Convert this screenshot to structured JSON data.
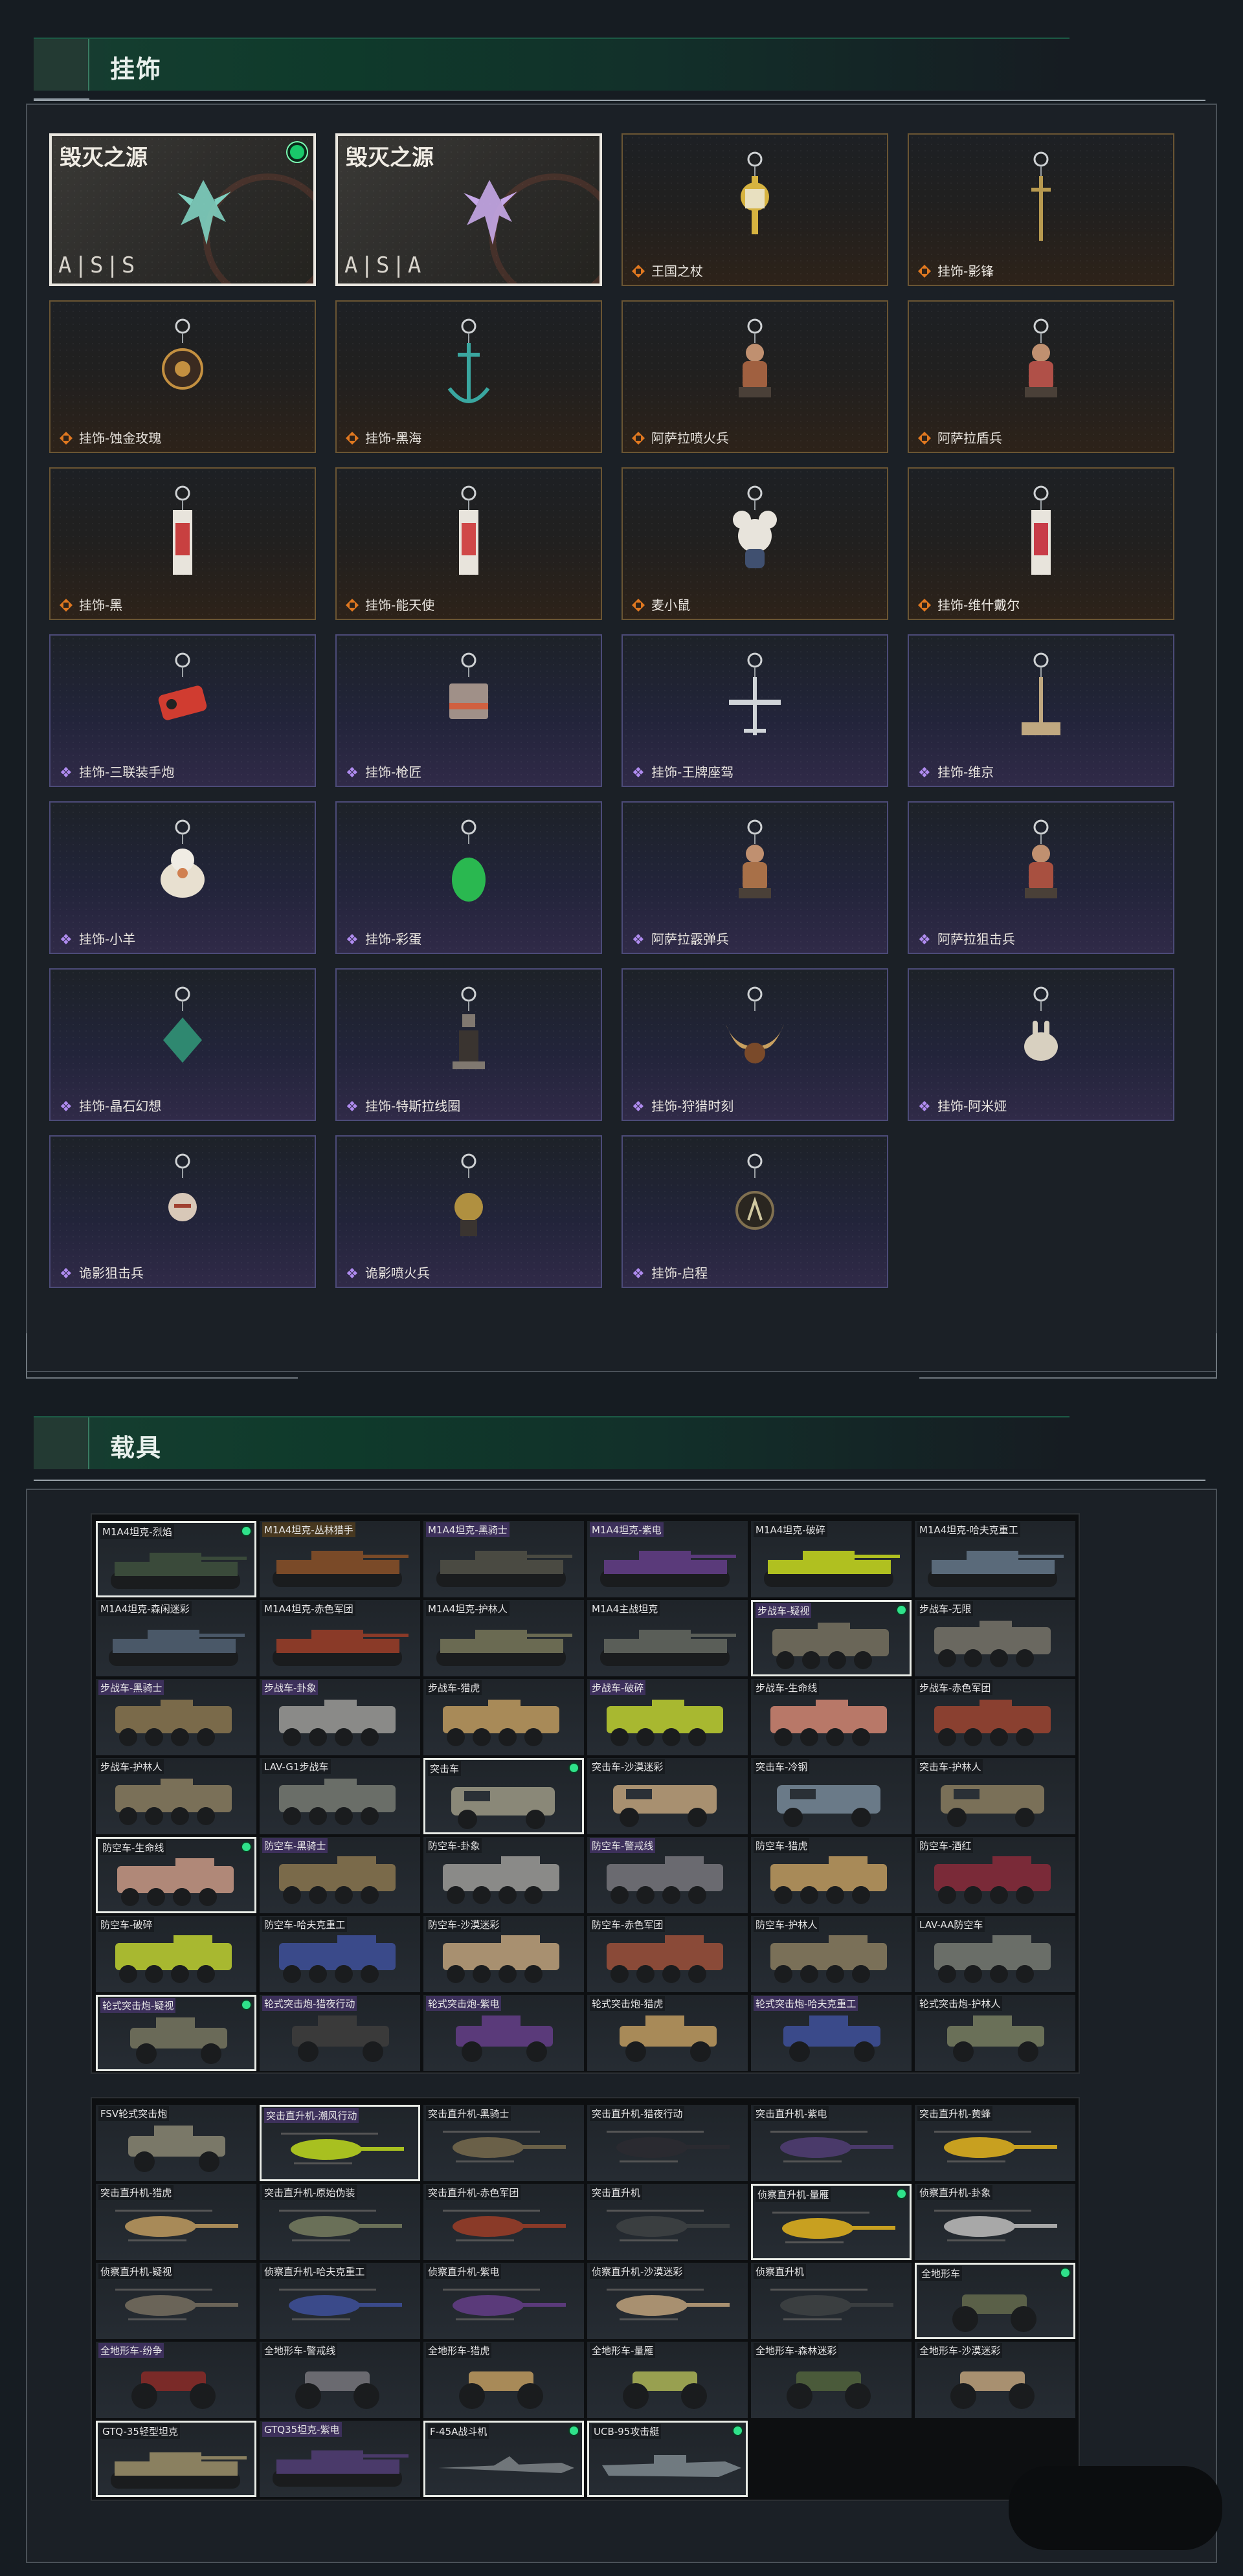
{
  "sections": {
    "accessories": {
      "title": "挂饰"
    },
    "vehicles": {
      "title": "载具"
    }
  },
  "accessory_cards": [
    {
      "label": "毁灭之源",
      "brand": "A|S|S",
      "style": "white",
      "equipped": true,
      "charm": "blade-charm-icon",
      "color": "#7fd0c0"
    },
    {
      "label": "毁灭之源",
      "brand": "A|S|A",
      "style": "white",
      "equipped": false,
      "charm": "blade-charm-icon",
      "color": "#c6a8e8"
    },
    {
      "label": "王国之杖",
      "style": "gold",
      "charm": "scepter-charm-icon",
      "color": "#d6b340"
    },
    {
      "label": "挂饰-影锋",
      "style": "gold",
      "charm": "sword-charm-icon",
      "color": "#b89a50"
    },
    {
      "label": "挂饰-蚀金玫瑰",
      "style": "gold",
      "charm": "rose-charm-icon",
      "color": "#c49040"
    },
    {
      "label": "挂饰-黑海",
      "style": "gold",
      "charm": "anchor-charm-icon",
      "color": "#3aa7a0"
    },
    {
      "label": "阿萨拉喷火兵",
      "style": "gold",
      "charm": "soldier-charm-icon",
      "color": "#a06040"
    },
    {
      "label": "阿萨拉盾兵",
      "style": "gold",
      "charm": "soldier-charm-icon",
      "color": "#b05048"
    },
    {
      "label": "挂饰-黑",
      "style": "gold",
      "charm": "tag-charm-icon",
      "color": "#c84040"
    },
    {
      "label": "挂饰-能天使",
      "style": "gold",
      "charm": "tag-charm-icon",
      "color": "#d04848"
    },
    {
      "label": "麦小鼠",
      "style": "gold",
      "charm": "mouse-charm-icon",
      "color": "#e8e4dc"
    },
    {
      "label": "挂饰-维什戴尔",
      "style": "gold",
      "charm": "tag-charm-icon",
      "color": "#c83c48"
    },
    {
      "label": "挂饰-三联装手炮",
      "style": "purple",
      "charm": "cannon-charm-icon",
      "color": "#d03c30"
    },
    {
      "label": "挂饰-枪匠",
      "style": "purple",
      "charm": "box-charm-icon",
      "color": "#a09088"
    },
    {
      "label": "挂饰-王牌座驾",
      "style": "purple",
      "charm": "plane-charm-icon",
      "color": "#d0d4d8"
    },
    {
      "label": "挂饰-维京",
      "style": "purple",
      "charm": "hammer-charm-icon",
      "color": "#c0a880"
    },
    {
      "label": "挂饰-小羊",
      "style": "purple",
      "charm": "sheep-charm-icon",
      "color": "#e8e0d0"
    },
    {
      "label": "挂饰-彩蛋",
      "style": "purple",
      "charm": "egg-charm-icon",
      "color": "#2ab850"
    },
    {
      "label": "阿萨拉霰弹兵",
      "style": "purple",
      "charm": "soldier-charm-icon",
      "color": "#a87048"
    },
    {
      "label": "阿萨拉狙击兵",
      "style": "purple",
      "charm": "soldier-charm-icon",
      "color": "#a85040"
    },
    {
      "label": "挂饰-晶石幻想",
      "style": "purple",
      "charm": "crystal-charm-icon",
      "color": "#2f8870"
    },
    {
      "label": "挂饰-特斯拉线圈",
      "style": "purple",
      "charm": "coil-charm-icon",
      "color": "#807870"
    },
    {
      "label": "挂饰-狩猎时刻",
      "style": "purple",
      "charm": "antler-charm-icon",
      "color": "#c8a060"
    },
    {
      "label": "挂饰-阿米娅",
      "style": "purple",
      "charm": "bunny-charm-icon",
      "color": "#d8d0c0"
    },
    {
      "label": "诡影狙击兵",
      "style": "purple",
      "charm": "mask-charm-icon",
      "color": "#d8c8b8"
    },
    {
      "label": "诡影喷火兵",
      "style": "purple",
      "charm": "tank-charm-icon",
      "color": "#b09040"
    },
    {
      "label": "挂饰-启程",
      "style": "purple",
      "charm": "badge-charm-icon",
      "color": "#807050"
    }
  ],
  "vehicle_groups": [
    {
      "tiles": [
        {
          "label": "M1A4坦克-烈焰",
          "kind": "tank",
          "color": "#3a4a3a",
          "sel": true,
          "dot": true,
          "tag": "plain"
        },
        {
          "label": "M1A4坦克-丛林猎手",
          "kind": "tank",
          "color": "#7a4a28",
          "tag": "gold"
        },
        {
          "label": "M1A4坦克-黑骑士",
          "kind": "tank",
          "color": "#4a4a42",
          "tag": "purp"
        },
        {
          "label": "M1A4坦克-紫电",
          "kind": "tank",
          "color": "#5a3a7a",
          "tag": "purp"
        },
        {
          "label": "M1A4坦克-破碎",
          "kind": "tank",
          "color": "#b0c020",
          "tag": "plain"
        },
        {
          "label": "M1A4坦克-哈夫克重工",
          "kind": "tank",
          "color": "#5a6a7a",
          "tag": "plain"
        },
        {
          "label": "M1A4坦克-森闲迷彩",
          "kind": "tank",
          "color": "#4a5868",
          "tag": "plain"
        },
        {
          "label": "M1A4坦克-赤色军团",
          "kind": "tank",
          "color": "#8a3a28",
          "tag": "plain"
        },
        {
          "label": "M1A4坦克-护林人",
          "kind": "tank",
          "color": "#6a6a52",
          "tag": "plain"
        },
        {
          "label": "M1A4主战坦克",
          "kind": "tank",
          "color": "#5a5e58",
          "tag": "plain"
        },
        {
          "label": "步战车-疑视",
          "kind": "apc",
          "color": "#6a6658",
          "sel": true,
          "dot": true,
          "tag": "purp"
        },
        {
          "label": "步战车-无限",
          "kind": "apc",
          "color": "#6a6860",
          "tag": "plain"
        },
        {
          "label": "步战车-黑骑士",
          "kind": "apc",
          "color": "#7a6a4a",
          "tag": "purp"
        },
        {
          "label": "步战车-卦象",
          "kind": "apc",
          "color": "#8a8a88",
          "tag": "purp"
        },
        {
          "label": "步战车-猎虎",
          "kind": "apc",
          "color": "#a88a58",
          "tag": "plain"
        },
        {
          "label": "步战车-破碎",
          "kind": "apc",
          "color": "#a8b830",
          "tag": "purp"
        },
        {
          "label": "步战车-生命线",
          "kind": "apc",
          "color": "#b87868",
          "tag": "plain"
        },
        {
          "label": "步战车-赤色军团",
          "kind": "apc",
          "color": "#8a4030",
          "tag": "plain"
        },
        {
          "label": "步战车-护林人",
          "kind": "apc",
          "color": "#7a7058",
          "tag": "plain"
        },
        {
          "label": "LAV-G1步战车",
          "kind": "apc",
          "color": "#6a6e68",
          "tag": "plain"
        },
        {
          "label": "突击车",
          "kind": "truck",
          "color": "#8a8878",
          "sel": true,
          "dot": true,
          "tag": "plain"
        },
        {
          "label": "突击车-沙漠迷彩",
          "kind": "truck",
          "color": "#a89070",
          "tag": "plain"
        },
        {
          "label": "突击车-冷钢",
          "kind": "truck",
          "color": "#6a7a88",
          "tag": "plain"
        },
        {
          "label": "突击车-护林人",
          "kind": "truck",
          "color": "#7a7058",
          "tag": "plain"
        },
        {
          "label": "防空车-生命线",
          "kind": "aa",
          "color": "#b08878",
          "sel": true,
          "dot": true,
          "tag": "plain"
        },
        {
          "label": "防空车-黑骑士",
          "kind": "aa",
          "color": "#7a6a4a",
          "tag": "purp"
        },
        {
          "label": "防空车-卦象",
          "kind": "aa",
          "color": "#8a8a88",
          "tag": "plain"
        },
        {
          "label": "防空车-警戒线",
          "kind": "aa",
          "color": "#6a6a70",
          "tag": "purp"
        },
        {
          "label": "防空车-猎虎",
          "kind": "aa",
          "color": "#a88a58",
          "tag": "plain"
        },
        {
          "label": "防空车-酒红",
          "kind": "aa",
          "color": "#7a2a38",
          "tag": "plain"
        },
        {
          "label": "防空车-破碎",
          "kind": "aa",
          "color": "#a8b830",
          "tag": "plain"
        },
        {
          "label": "防空车-哈夫克重工",
          "kind": "aa",
          "color": "#3a4a8a",
          "tag": "plain"
        },
        {
          "label": "防空车-沙漠迷彩",
          "kind": "aa",
          "color": "#a89070",
          "tag": "plain"
        },
        {
          "label": "防空车-赤色军团",
          "kind": "aa",
          "color": "#8a4a38",
          "tag": "plain"
        },
        {
          "label": "防空车-护林人",
          "kind": "aa",
          "color": "#7a7058",
          "tag": "plain"
        },
        {
          "label": "LAV-AA防空车",
          "kind": "aa",
          "color": "#6a6e68",
          "tag": "plain"
        },
        {
          "label": "轮式突击炮-疑视",
          "kind": "buggy",
          "color": "#6a6a58",
          "sel": true,
          "dot": true,
          "tag": "purp"
        },
        {
          "label": "轮式突击炮-猎夜行动",
          "kind": "buggy",
          "color": "#3a3a3a",
          "tag": "purp"
        },
        {
          "label": "轮式突击炮-紫电",
          "kind": "buggy",
          "color": "#5a3a7a",
          "tag": "purp"
        },
        {
          "label": "轮式突击炮-猎虎",
          "kind": "buggy",
          "color": "#a88a58",
          "tag": "plain"
        },
        {
          "label": "轮式突击炮-哈夫克重工",
          "kind": "buggy",
          "color": "#3a4a8a",
          "tag": "purp"
        },
        {
          "label": "轮式突击炮-护林人",
          "kind": "buggy",
          "color": "#6a7058",
          "tag": "plain"
        }
      ]
    },
    {
      "tiles": [
        {
          "label": "FSV轮式突击炮",
          "kind": "buggy",
          "color": "#7a7868",
          "tag": "plain"
        },
        {
          "label": "突击直升机-潮风行动",
          "kind": "heli",
          "color": "#a8c020",
          "sel": true,
          "tag": "purp"
        },
        {
          "label": "突击直升机-黑骑士",
          "kind": "heli",
          "color": "#6a6048",
          "tag": "plain"
        },
        {
          "label": "突击直升机-猎夜行动",
          "kind": "heli",
          "color": "#2a2a30",
          "tag": "plain"
        },
        {
          "label": "突击直升机-紫电",
          "kind": "heli",
          "color": "#4a3a6a",
          "tag": "plain"
        },
        {
          "label": "突击直升机-黄蜂",
          "kind": "heli",
          "color": "#c8a020",
          "tag": "plain"
        },
        {
          "label": "突击直升机-猎虎",
          "kind": "heli",
          "color": "#a88a58",
          "tag": "plain"
        },
        {
          "label": "突击直升机-原始伪装",
          "kind": "heli",
          "color": "#6a7058",
          "tag": "plain"
        },
        {
          "label": "突击直升机-赤色军团",
          "kind": "heli",
          "color": "#8a3a28",
          "tag": "plain"
        },
        {
          "label": "突击直升机",
          "kind": "heli",
          "color": "#3a3e40",
          "tag": "plain"
        },
        {
          "label": "侦察直升机-量雁",
          "kind": "heli2",
          "color": "#c8a020",
          "sel": true,
          "dot": true,
          "tag": "plain"
        },
        {
          "label": "侦察直升机-卦象",
          "kind": "heli2",
          "color": "#a8a8a8",
          "tag": "plain"
        },
        {
          "label": "侦察直升机-疑视",
          "kind": "heli2",
          "color": "#6a6458",
          "tag": "plain"
        },
        {
          "label": "侦察直升机-哈夫克重工",
          "kind": "heli2",
          "color": "#3a4a8a",
          "tag": "plain"
        },
        {
          "label": "侦察直升机-紫电",
          "kind": "heli2",
          "color": "#5a3a7a",
          "tag": "plain"
        },
        {
          "label": "侦察直升机-沙漠迷彩",
          "kind": "heli2",
          "color": "#a89070",
          "tag": "plain"
        },
        {
          "label": "侦察直升机",
          "kind": "heli2",
          "color": "#3a3e40",
          "tag": "plain"
        },
        {
          "label": "全地形车",
          "kind": "atv",
          "color": "#5a6048",
          "sel": true,
          "dot": true,
          "tag": "plain"
        },
        {
          "label": "全地形车-纷争",
          "kind": "atv",
          "color": "#7a2a28",
          "tag": "purp"
        },
        {
          "label": "全地形车-警戒线",
          "kind": "atv",
          "color": "#6a6a70",
          "tag": "plain"
        },
        {
          "label": "全地形车-猎虎",
          "kind": "atv",
          "color": "#a88a58",
          "tag": "plain"
        },
        {
          "label": "全地形车-量雁",
          "kind": "atv",
          "color": "#98a050",
          "tag": "plain"
        },
        {
          "label": "全地形车-森林迷彩",
          "kind": "atv",
          "color": "#4a5a3a",
          "tag": "plain"
        },
        {
          "label": "全地形车-沙漠迷彩",
          "kind": "atv",
          "color": "#a89070",
          "tag": "plain"
        },
        {
          "label": "GTQ-35轻型坦克",
          "kind": "tank",
          "color": "#8a8060",
          "sel": true,
          "tag": "plain"
        },
        {
          "label": "GTQ35坦克-紫电",
          "kind": "tank",
          "color": "#4a3a6a",
          "tag": "purp"
        },
        {
          "label": "F-45A战斗机",
          "kind": "jet",
          "color": "#70767a",
          "sel": true,
          "dot": true,
          "tag": "plain"
        },
        {
          "label": "UCB-95攻击艇",
          "kind": "boat",
          "color": "#707a80",
          "sel": true,
          "dot": true,
          "tag": "plain"
        }
      ]
    }
  ]
}
